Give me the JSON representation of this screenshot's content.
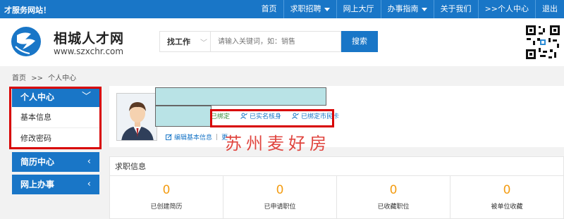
{
  "topbar": {
    "slogan": "才服务网站！",
    "nav": [
      {
        "label": "首页",
        "dropdown": false
      },
      {
        "label": "求职招聘",
        "dropdown": true
      },
      {
        "label": "网上大厅",
        "dropdown": false
      },
      {
        "label": "办事指南",
        "dropdown": true
      },
      {
        "label": "关于我们",
        "dropdown": false
      },
      {
        "label": ">>个人中心",
        "dropdown": false
      },
      {
        "label": "退出",
        "dropdown": false
      }
    ]
  },
  "header": {
    "logo_title": "相城人才网",
    "logo_url": "www.szxchr.com",
    "search_type": "找工作",
    "search_placeholder": "请输入关键词，如：销售",
    "search_button": "搜索"
  },
  "breadcrumb": {
    "home": "首页",
    "sep": ">>",
    "current": "个人中心"
  },
  "sidebar": {
    "personal_center": "个人中心",
    "sub_items": [
      "基本信息",
      "修改密码"
    ],
    "resume_center": "简历中心",
    "online_affairs": "网上办事"
  },
  "profile": {
    "badges": [
      "已绑定",
      "已实名核身",
      "已绑定市民卡"
    ],
    "edit_basic": "编辑基本信息",
    "edit_more": "更",
    "watermark": "苏州麦好房"
  },
  "job_info": {
    "title": "求职信息",
    "stats": [
      {
        "value": "0",
        "label": "已创建简历"
      },
      {
        "value": "0",
        "label": "已申请职位"
      },
      {
        "value": "0",
        "label": "已收藏职位"
      },
      {
        "value": "0",
        "label": "被单位收藏"
      }
    ]
  },
  "colors": {
    "brand_blue": "#1976c7",
    "highlight_red": "#d80000",
    "stat_orange": "#f39c12",
    "cover_teal": "#b9e3e6"
  }
}
